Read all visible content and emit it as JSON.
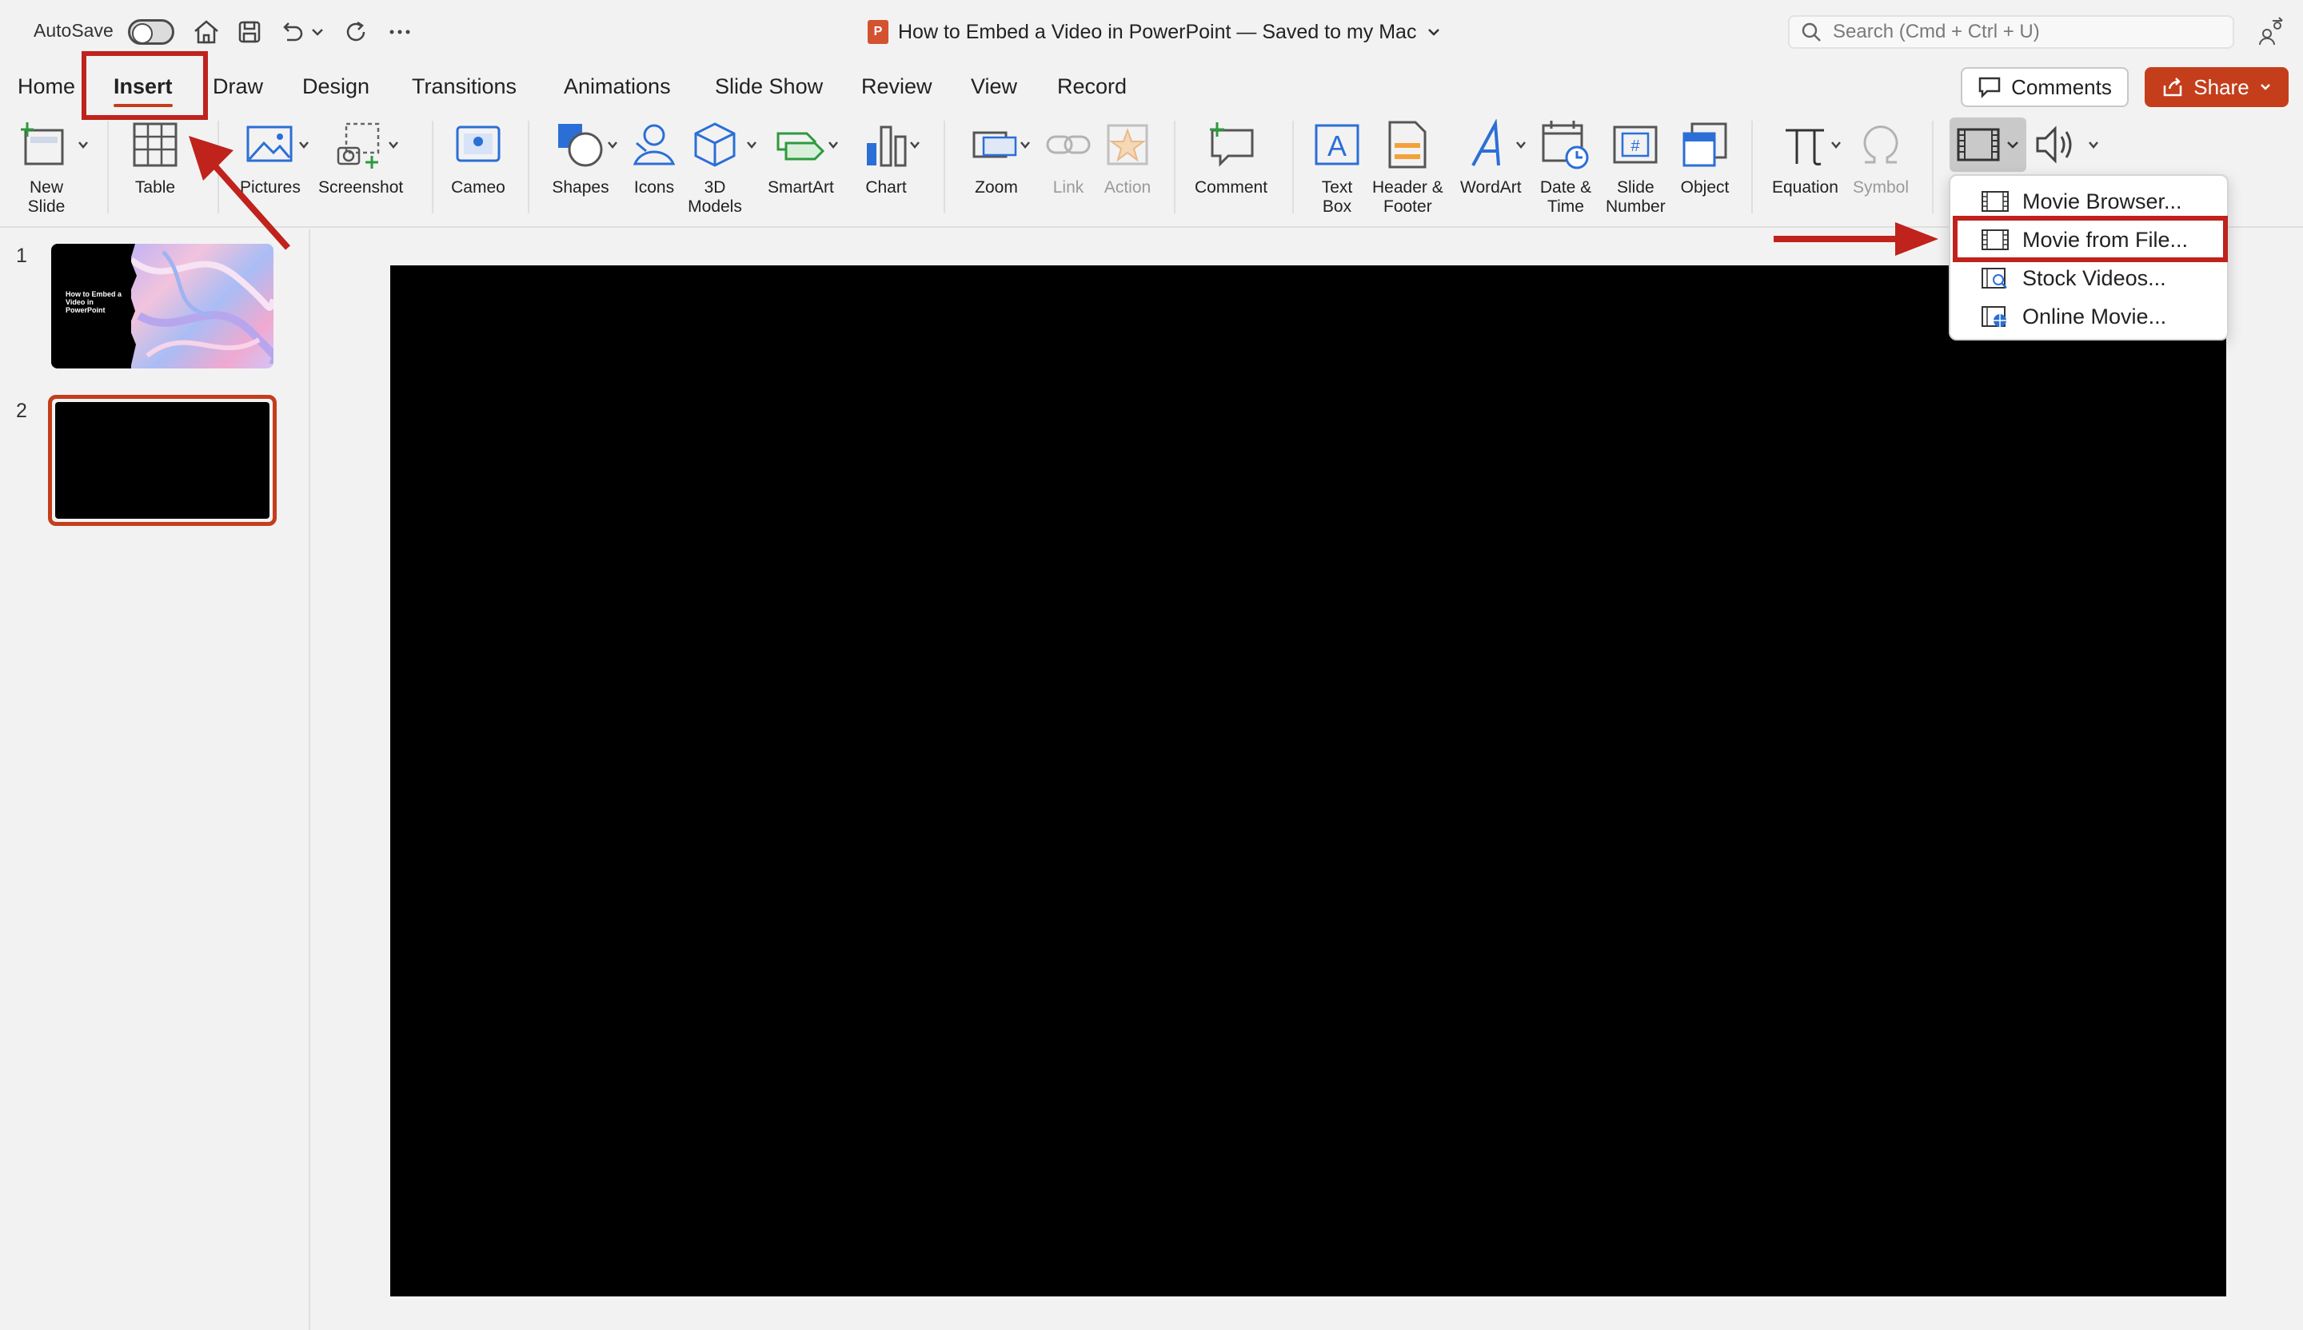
{
  "titlebar": {
    "autosave_label": "AutoSave",
    "document_title": "How to Embed a Video in PowerPoint — Saved to my Mac",
    "app_badge": "P",
    "search_placeholder": "Search (Cmd + Ctrl + U)"
  },
  "tabs": [
    {
      "label": "Home"
    },
    {
      "label": "Insert"
    },
    {
      "label": "Draw"
    },
    {
      "label": "Design"
    },
    {
      "label": "Transitions"
    },
    {
      "label": "Animations"
    },
    {
      "label": "Slide Show"
    },
    {
      "label": "Review"
    },
    {
      "label": "View"
    },
    {
      "label": "Record"
    }
  ],
  "active_tab": "Insert",
  "header_buttons": {
    "comments": "Comments",
    "share": "Share"
  },
  "ribbon": {
    "new_slide": "New\nSlide",
    "table": "Table",
    "pictures": "Pictures",
    "screenshot": "Screenshot",
    "cameo": "Cameo",
    "shapes": "Shapes",
    "icons": "Icons",
    "models_3d": "3D\nModels",
    "smartart": "SmartArt",
    "chart": "Chart",
    "zoom": "Zoom",
    "link": "Link",
    "action": "Action",
    "comment": "Comment",
    "text_box": "Text\nBox",
    "header_footer": "Header &\nFooter",
    "wordart": "WordArt",
    "date_time": "Date &\nTime",
    "slide_number": "Slide\nNumber",
    "object": "Object",
    "equation": "Equation",
    "symbol": "Symbol"
  },
  "slides_pane": {
    "slides": [
      {
        "number": "1",
        "title_text": "How to Embed a Video in PowerPoint"
      },
      {
        "number": "2"
      }
    ],
    "selected_slide": 2
  },
  "video_menu": {
    "items": [
      {
        "label": "Movie Browser..."
      },
      {
        "label": "Movie from File..."
      },
      {
        "label": "Stock Videos..."
      },
      {
        "label": "Online Movie..."
      }
    ],
    "highlighted_item": "Movie from File..."
  },
  "colors": {
    "accent": "#c43e1c",
    "annotation_red": "#c0221c",
    "icon_blue": "#2b6fd6",
    "ribbon_bg": "#f3f2f3"
  }
}
